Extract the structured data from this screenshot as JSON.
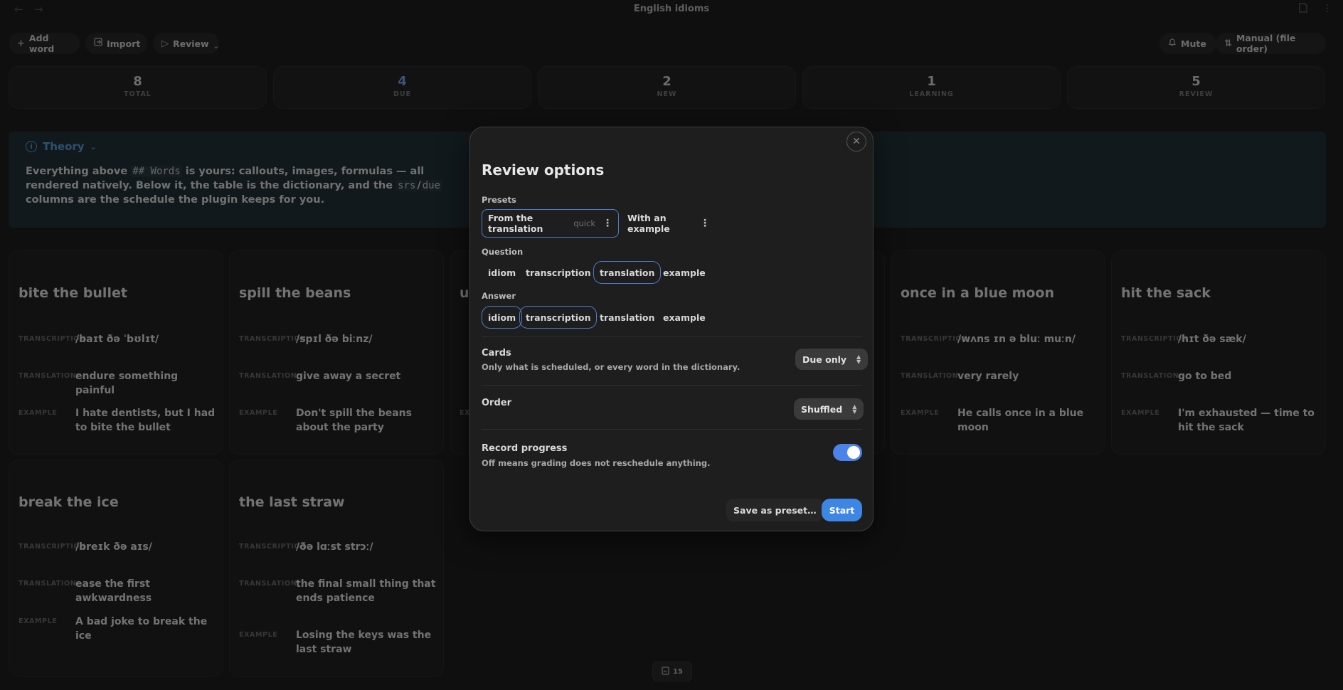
{
  "window": {
    "title": "English idioms"
  },
  "toolbar": {
    "add_word": "Add word",
    "import": "Import",
    "review": "Review",
    "mute": "Mute",
    "order": "Manual (file order)"
  },
  "stats": [
    {
      "value": "8",
      "label": "TOTAL"
    },
    {
      "value": "4",
      "label": "DUE"
    },
    {
      "value": "2",
      "label": "NEW"
    },
    {
      "value": "1",
      "label": "LEARNING"
    },
    {
      "value": "5",
      "label": "REVIEW"
    }
  ],
  "theory": {
    "heading": "Theory",
    "t1": "Everything above ",
    "c1": "## Words",
    "t2": " is yours: callouts, images, formulas — all rendered natively. Below it, the table is the dictionary, and the ",
    "c2": "srs",
    "t3": "/",
    "c3": "due",
    "t4": " columns are the schedule the plugin keeps for you."
  },
  "field_labels": {
    "transcription": "TRANSCRIPTION",
    "translation": "TRANSLATION",
    "example": "EXAMPLE"
  },
  "cards": [
    {
      "word": "bite the bullet",
      "transcription": "/baɪt ðə ˈbʊlɪt/",
      "translation": "endure something painful",
      "example": "I hate dentists, but I had to bite the bullet"
    },
    {
      "word": "spill the beans",
      "transcription": "/spɪl ðə biːnz/",
      "translation": "give away a secret",
      "example": "Don't spill the beans about the party"
    },
    {
      "word": "once in a blue moon",
      "transcription": "/wʌns ɪn ə bluː muːn/",
      "translation": "very rarely",
      "example": "He calls once in a blue moon"
    },
    {
      "word": "hit the sack",
      "transcription": "/hɪt ðə sæk/",
      "translation": "go to bed",
      "example": "I'm exhausted — time to hit the sack"
    },
    {
      "word": "break the ice",
      "transcription": "/breɪk ðə aɪs/",
      "translation": "ease the first awkwardness",
      "example": "A bad joke to break the ice"
    },
    {
      "word": "the last straw",
      "transcription": "/ðə lɑːst strɔː/",
      "translation": "the final small thing that ends patience",
      "example": "Losing the keys was the last straw"
    }
  ],
  "partial_card_word_fragment": "u",
  "page_badge": "15",
  "modal": {
    "title": "Review options",
    "presets_label": "Presets",
    "presets": [
      {
        "name": "From the translation",
        "tag": "quick"
      },
      {
        "name": "With an example",
        "tag": ""
      }
    ],
    "question_label": "Question",
    "question_options": [
      "idiom",
      "transcription",
      "translation",
      "example"
    ],
    "question_selected": [
      "translation"
    ],
    "answer_label": "Answer",
    "answer_options": [
      "idiom",
      "transcription",
      "translation",
      "example"
    ],
    "answer_selected": [
      "idiom",
      "transcription"
    ],
    "cards_title": "Cards",
    "cards_desc": "Only what is scheduled, or every word in the dictionary.",
    "cards_value": "Due only",
    "order_title": "Order",
    "order_value": "Shuffled",
    "record_title": "Record progress",
    "record_desc": "Off means grading does not reschedule anything.",
    "record_on": true,
    "save_preset": "Save as preset…",
    "start": "Start"
  }
}
